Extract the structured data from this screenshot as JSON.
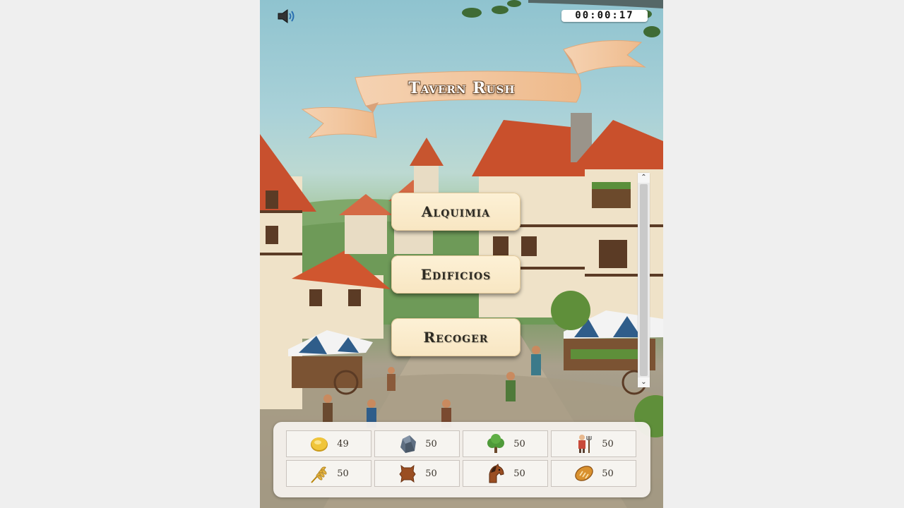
{
  "timer": "00:00:17",
  "title": "Tavern Rush",
  "menu": [
    {
      "label": "Alquimia"
    },
    {
      "label": "Edificios"
    },
    {
      "label": "Recoger"
    }
  ],
  "resources": [
    {
      "icon": "gold-coin-icon",
      "value": "49"
    },
    {
      "icon": "stone-icon",
      "value": "50"
    },
    {
      "icon": "tree-icon",
      "value": "50"
    },
    {
      "icon": "worker-icon",
      "value": "50"
    },
    {
      "icon": "wheat-icon",
      "value": "50"
    },
    {
      "icon": "leather-icon",
      "value": "50"
    },
    {
      "icon": "horse-icon",
      "value": "50"
    },
    {
      "icon": "bread-icon",
      "value": "50"
    }
  ],
  "colors": {
    "button_bg": "#fbeccd",
    "panel_bg": "#f4f0ec",
    "banner": "#f2c39a",
    "sound_icon": "#2a6fb0"
  }
}
